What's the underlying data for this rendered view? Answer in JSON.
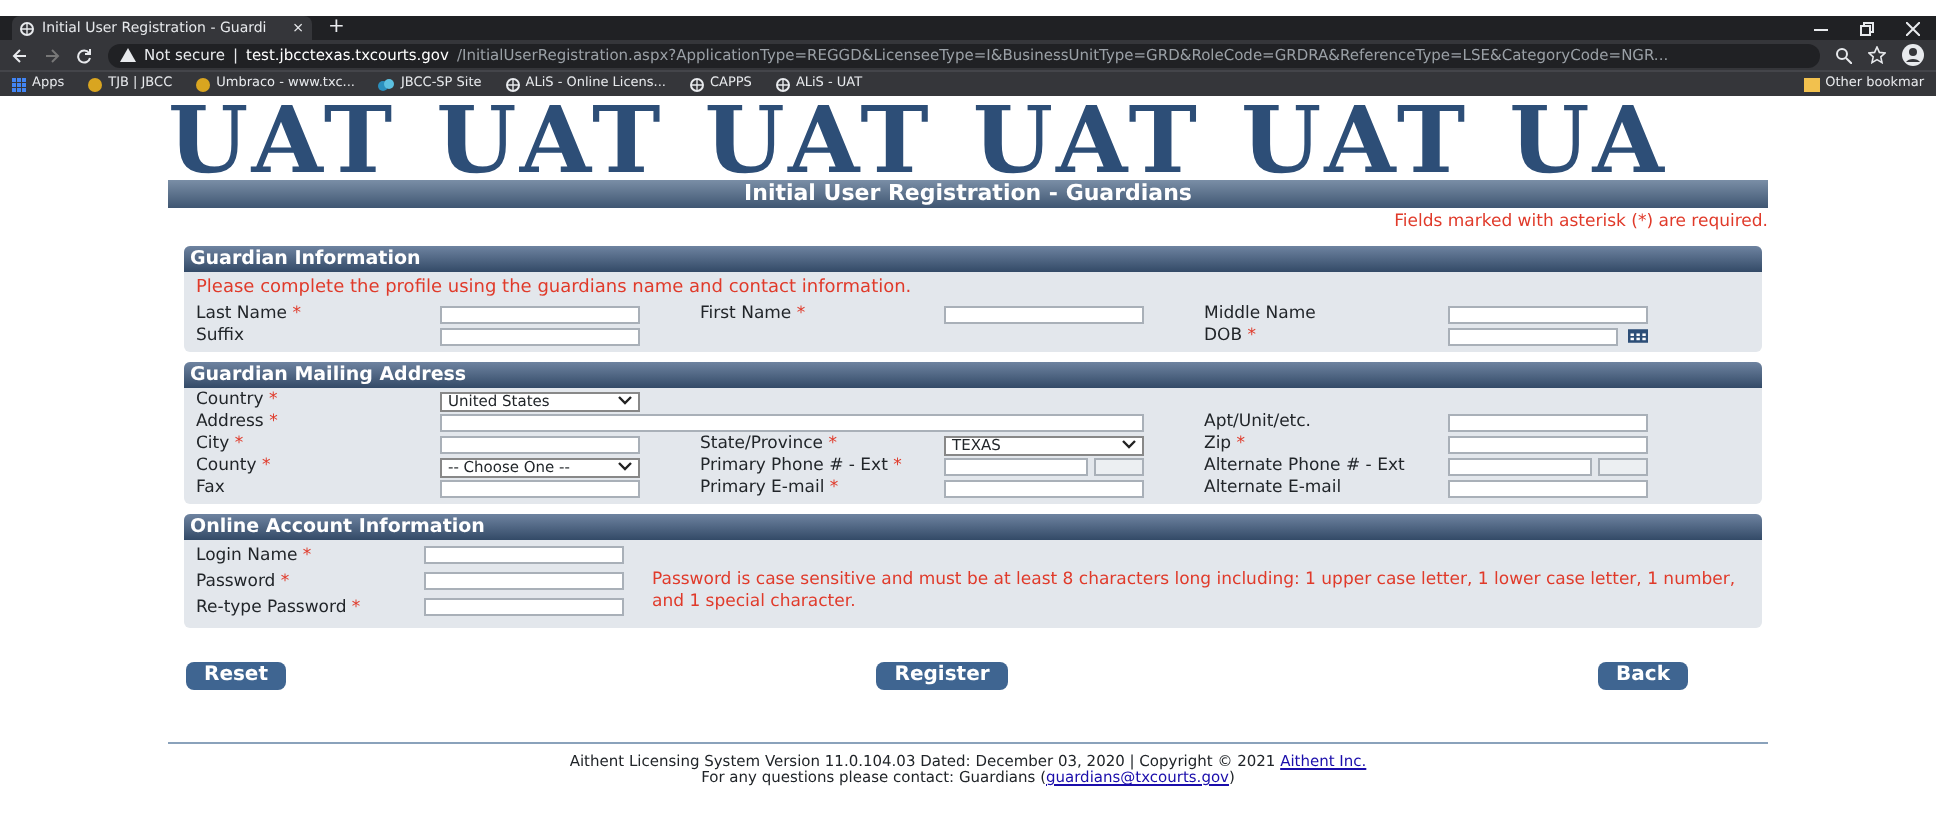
{
  "browser": {
    "tab": {
      "title": "Initial User Registration - Guardi",
      "close": "×"
    },
    "new_tab": "+",
    "address": {
      "security": "Not secure",
      "separator": "|",
      "host": "test.jbcctexas.txcourts.gov",
      "path": "/InitialUserRegistration.aspx?ApplicationType=REGGD&LicenseeType=I&BusinessUnitType=GRD&RoleCode=GRDRA&ReferenceType=LSE&CategoryCode=NGR..."
    },
    "bookmarks": [
      {
        "label": "Apps",
        "kind": "apps"
      },
      {
        "label": "TJB | JBCC",
        "kind": "site"
      },
      {
        "label": "Umbraco - www.txc...",
        "kind": "site"
      },
      {
        "label": "JBCC-SP Site",
        "kind": "share"
      },
      {
        "label": "ALiS - Online Licens...",
        "kind": "globe"
      },
      {
        "label": "CAPPS",
        "kind": "globe"
      },
      {
        "label": "ALiS - UAT",
        "kind": "globe"
      }
    ],
    "other_bookmarks": "Other bookmar"
  },
  "banner": "UAT UAT UAT UAT UAT UA",
  "title": "Initial User Registration - Guardians",
  "required_note": "Fields marked with asterisk (*) are required.",
  "required_mark": "*",
  "sections": [
    {
      "title": "Guardian Information",
      "intro": "Please complete the profile using the guardians name and contact information.",
      "rows": [
        {
          "left": {
            "label": "Last Name",
            "required": true,
            "kind": "text"
          },
          "middle": {
            "label": "First Name",
            "required": true,
            "kind": "text"
          },
          "right": {
            "label": "Middle Name",
            "required": false,
            "kind": "text"
          }
        },
        {
          "left": {
            "label": "Suffix",
            "required": false,
            "kind": "text"
          },
          "right": {
            "label": "DOB",
            "required": true,
            "kind": "date"
          }
        }
      ]
    },
    {
      "title": "Guardian Mailing Address",
      "rows": [
        {
          "left": {
            "label": "Country",
            "required": true,
            "kind": "select",
            "value": "United States"
          }
        },
        {
          "left": {
            "label": "Address",
            "required": true,
            "kind": "wide"
          },
          "right": {
            "label": "Apt/Unit/etc.",
            "required": false,
            "kind": "text"
          }
        },
        {
          "left": {
            "label": "City",
            "required": true,
            "kind": "text"
          },
          "middle": {
            "label": "State/Province",
            "required": true,
            "kind": "select",
            "value": "TEXAS"
          },
          "right": {
            "label": "Zip",
            "required": true,
            "kind": "text"
          }
        },
        {
          "left": {
            "label": "County",
            "required": true,
            "kind": "select",
            "value": "-- Choose One --"
          },
          "middle": {
            "label": "Primary Phone # - Ext",
            "required": true,
            "kind": "phone"
          },
          "right": {
            "label": "Alternate Phone # - Ext",
            "required": false,
            "kind": "phone"
          }
        },
        {
          "left": {
            "label": "Fax",
            "required": false,
            "kind": "text"
          },
          "middle": {
            "label": "Primary E-mail",
            "required": true,
            "kind": "text"
          },
          "right": {
            "label": "Alternate E-mail",
            "required": false,
            "kind": "text"
          }
        }
      ]
    },
    {
      "title": "Online Account Information",
      "account": [
        {
          "label": "Login Name",
          "required": true
        },
        {
          "label": "Password",
          "required": true
        },
        {
          "label": "Re-type Password",
          "required": true
        }
      ],
      "note": "Password is case sensitive and must be at least 8 characters long including: 1 upper case letter, 1 lower case letter, 1 number, and 1 special character."
    }
  ],
  "buttons": [
    "Reset",
    "Register",
    "Back"
  ],
  "footer": {
    "line1": "Aithent Licensing System Version 11.0.104.03 Dated: December 03, 2020 | Copyright © 2021",
    "line1_link": "Aithent Inc.",
    "line2": "For any questions please contact: Guardians (",
    "line2_link": "guardians@txcourts.gov",
    "line2_end": ")"
  }
}
